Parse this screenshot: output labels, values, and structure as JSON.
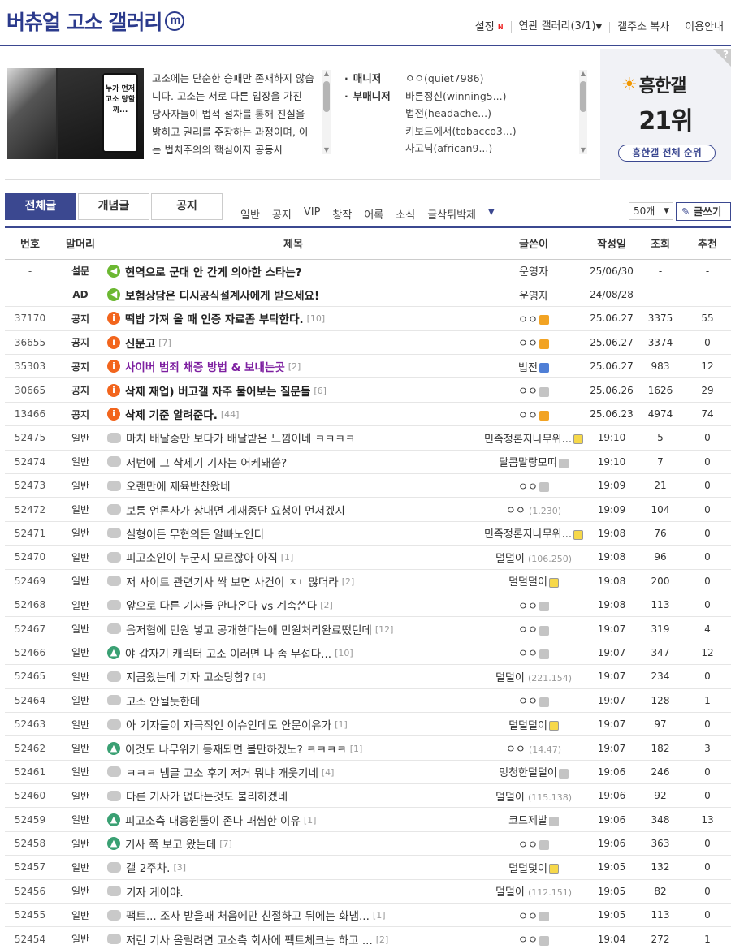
{
  "gallery": {
    "title": "버츄얼 고소 갤러리",
    "mark": "m"
  },
  "top_menu": {
    "settings": "설정",
    "new_mark": "N",
    "related": "연관 갤러리(3/1)",
    "copy_addr": "갤주소 복사",
    "guide": "이용안내"
  },
  "cover": {
    "bubble_text": "누가 먼저 고소 당할까..."
  },
  "description": "고소에는 단순한 승패만 존재하지 않습니다. 고소는 서로 다른 입장을 가진 당사자들이 법적 절차를 통해 진실을 밝히고 권리를 주장하는 과정이며, 이는 법치주의의 핵심이자 공동사",
  "managers": {
    "manager_label": "매니저",
    "manager_name": "ㅇㅇ(quiet7986)",
    "sub_label": "부매니저",
    "sub_names": [
      "바른정신(winning5...)",
      "법전(headache...)",
      "키보드에서(tobacco3...)",
      "사고닉(african9...)"
    ]
  },
  "rank": {
    "title": "흥한갤",
    "value": "21위",
    "button": "흥한갤 전체 순위",
    "help": "?"
  },
  "tabs": [
    "전체글",
    "개념글",
    "공지"
  ],
  "subheads": [
    "일반",
    "공지",
    "VIP",
    "창작",
    "어록",
    "소식",
    "글삭튀박제"
  ],
  "list_controls": {
    "per_page": "50개",
    "write": "글쓰기"
  },
  "columns": [
    "번호",
    "말머리",
    "제목",
    "글쓴이",
    "작성일",
    "조회",
    "추천"
  ],
  "rows": [
    {
      "num": "-",
      "head": "설문",
      "icon": "speaker",
      "title": "현역으로 군대 안 간게 의아한 스타는?",
      "count": "",
      "writer": "운영자",
      "ip": "",
      "badge": "",
      "date": "25/06/30",
      "views": "-",
      "rec": "-",
      "type": "notice"
    },
    {
      "num": "-",
      "head": "AD",
      "icon": "speaker",
      "title": "보험상담은 디시공식설계사에게 받으세요!",
      "count": "",
      "writer": "운영자",
      "ip": "",
      "badge": "",
      "date": "24/08/28",
      "views": "-",
      "rec": "-",
      "type": "notice"
    },
    {
      "num": "37170",
      "head": "공지",
      "icon": "notice-i",
      "title": "떡밥 가져 올 때 인증 자료좀 부탁한다.",
      "count": "[10]",
      "writer": "ㅇㅇ",
      "ip": "",
      "badge": "orange",
      "date": "25.06.27",
      "views": "3375",
      "rec": "55",
      "type": "notice"
    },
    {
      "num": "36655",
      "head": "공지",
      "icon": "notice-i",
      "title": "신문고",
      "count": "[7]",
      "writer": "ㅇㅇ",
      "ip": "",
      "badge": "orange",
      "date": "25.06.27",
      "views": "3374",
      "rec": "0",
      "type": "notice"
    },
    {
      "num": "35303",
      "head": "공지",
      "icon": "notice-i",
      "title": "사이버 범죄 채증 방법 & 보내는곳",
      "count": "[2]",
      "writer": "법전",
      "ip": "",
      "badge": "blue",
      "date": "25.06.27",
      "views": "983",
      "rec": "12",
      "type": "notice purple"
    },
    {
      "num": "30665",
      "head": "공지",
      "icon": "notice-i",
      "title": "삭제 재업) 버고갤 자주 물어보는 질문들",
      "count": "[6]",
      "writer": "ㅇㅇ",
      "ip": "",
      "badge": "gray",
      "date": "25.06.26",
      "views": "1626",
      "rec": "29",
      "type": "notice"
    },
    {
      "num": "13466",
      "head": "공지",
      "icon": "notice-i",
      "title": "삭제 기준 알려준다.",
      "count": "[44]",
      "writer": "ㅇㅇ",
      "ip": "",
      "badge": "orange",
      "date": "25.06.23",
      "views": "4974",
      "rec": "74",
      "type": "notice"
    },
    {
      "num": "52475",
      "head": "일반",
      "icon": "text",
      "title": "마치 배달중만 보다가 배달받은 느낌이네 ㅋㅋㅋㅋ",
      "count": "",
      "writer": "민족정론지나무위...",
      "ip": "",
      "badge": "yellow",
      "date": "19:10",
      "views": "5",
      "rec": "0",
      "type": ""
    },
    {
      "num": "52474",
      "head": "일반",
      "icon": "text",
      "title": "저번에 그 삭제기 기자는 어케돼씀?",
      "count": "",
      "writer": "달콤말랑모띠",
      "ip": "",
      "badge": "gray",
      "date": "19:10",
      "views": "7",
      "rec": "0",
      "type": ""
    },
    {
      "num": "52473",
      "head": "일반",
      "icon": "text",
      "title": "오랜만에 제육반찬왔네",
      "count": "",
      "writer": "ㅇㅇ",
      "ip": "",
      "badge": "gray",
      "date": "19:09",
      "views": "21",
      "rec": "0",
      "type": ""
    },
    {
      "num": "52472",
      "head": "일반",
      "icon": "text",
      "title": "보통 언론사가 상대면 게재중단 요청이 먼저겠지",
      "count": "",
      "writer": "ㅇㅇ",
      "ip": "(1.230)",
      "badge": "",
      "date": "19:09",
      "views": "104",
      "rec": "0",
      "type": ""
    },
    {
      "num": "52471",
      "head": "일반",
      "icon": "text",
      "title": "실형이든 무협의든 알빠노인디",
      "count": "",
      "writer": "민족정론지나무위...",
      "ip": "",
      "badge": "yellow",
      "date": "19:08",
      "views": "76",
      "rec": "0",
      "type": ""
    },
    {
      "num": "52470",
      "head": "일반",
      "icon": "text",
      "title": "피고소인이 누군지 모르잖아 아직",
      "count": "[1]",
      "writer": "덜덜이",
      "ip": "(106.250)",
      "badge": "",
      "date": "19:08",
      "views": "96",
      "rec": "0",
      "type": ""
    },
    {
      "num": "52469",
      "head": "일반",
      "icon": "text",
      "title": "저 사이트 관련기사 싹 보면 사건이 ㅈㄴ많더라",
      "count": "[2]",
      "writer": "덜덜덜이",
      "ip": "",
      "badge": "yellow",
      "date": "19:08",
      "views": "200",
      "rec": "0",
      "type": ""
    },
    {
      "num": "52468",
      "head": "일반",
      "icon": "text",
      "title": "앞으로 다른 기사들 안나온다 vs 계속쓴다",
      "count": "[2]",
      "writer": "ㅇㅇ",
      "ip": "",
      "badge": "gray",
      "date": "19:08",
      "views": "113",
      "rec": "0",
      "type": ""
    },
    {
      "num": "52467",
      "head": "일반",
      "icon": "text",
      "title": "음저협에 민원 넣고 공개한다는애 민원처리완료떴던데",
      "count": "[12]",
      "writer": "ㅇㅇ",
      "ip": "",
      "badge": "gray",
      "date": "19:07",
      "views": "319",
      "rec": "4",
      "type": ""
    },
    {
      "num": "52466",
      "head": "일반",
      "icon": "img",
      "title": "야 갑자기 캐릭터 고소 이러면 나 좀 무섭다...",
      "count": "[10]",
      "writer": "ㅇㅇ",
      "ip": "",
      "badge": "gray",
      "date": "19:07",
      "views": "347",
      "rec": "12",
      "type": ""
    },
    {
      "num": "52465",
      "head": "일반",
      "icon": "text",
      "title": "지금왔는데 기자 고소당함?",
      "count": "[4]",
      "writer": "덜덜이",
      "ip": "(221.154)",
      "badge": "",
      "date": "19:07",
      "views": "234",
      "rec": "0",
      "type": ""
    },
    {
      "num": "52464",
      "head": "일반",
      "icon": "text",
      "title": "고소 안될듯한데",
      "count": "",
      "writer": "ㅇㅇ",
      "ip": "",
      "badge": "gray",
      "date": "19:07",
      "views": "128",
      "rec": "1",
      "type": ""
    },
    {
      "num": "52463",
      "head": "일반",
      "icon": "text",
      "title": "아 기자들이 자극적인 이슈인데도 안문이유가",
      "count": "[1]",
      "writer": "덜덜덜이",
      "ip": "",
      "badge": "yellow",
      "date": "19:07",
      "views": "97",
      "rec": "0",
      "type": ""
    },
    {
      "num": "52462",
      "head": "일반",
      "icon": "img",
      "title": "이것도 나무위키 등재되면 볼만하겠노? ㅋㅋㅋㅋ",
      "count": "[1]",
      "writer": "ㅇㅇ",
      "ip": "(14.47)",
      "badge": "",
      "date": "19:07",
      "views": "182",
      "rec": "3",
      "type": ""
    },
    {
      "num": "52461",
      "head": "일반",
      "icon": "text",
      "title": "ㅋㅋㅋ 넴글 고소 후기 저거 뭐냐 개웃기네",
      "count": "[4]",
      "writer": "멍청한덜덜이",
      "ip": "",
      "badge": "gray",
      "date": "19:06",
      "views": "246",
      "rec": "0",
      "type": ""
    },
    {
      "num": "52460",
      "head": "일반",
      "icon": "text",
      "title": "다른 기사가 없다는것도 불리하겠네",
      "count": "",
      "writer": "덜덜이",
      "ip": "(115.138)",
      "badge": "",
      "date": "19:06",
      "views": "92",
      "rec": "0",
      "type": ""
    },
    {
      "num": "52459",
      "head": "일반",
      "icon": "img",
      "title": "피고소측 대응원툴이 존나 괘씸한 이유",
      "count": "[1]",
      "writer": "코드제발",
      "ip": "",
      "badge": "gray",
      "date": "19:06",
      "views": "348",
      "rec": "13",
      "type": ""
    },
    {
      "num": "52458",
      "head": "일반",
      "icon": "img",
      "title": "기사 쭉 보고 왔는데",
      "count": "[7]",
      "writer": "ㅇㅇ",
      "ip": "",
      "badge": "gray",
      "date": "19:06",
      "views": "363",
      "rec": "0",
      "type": ""
    },
    {
      "num": "52457",
      "head": "일반",
      "icon": "text",
      "title": "갤 2주차.",
      "count": "[3]",
      "writer": "덜덜덫이",
      "ip": "",
      "badge": "yellow",
      "date": "19:05",
      "views": "132",
      "rec": "0",
      "type": ""
    },
    {
      "num": "52456",
      "head": "일반",
      "icon": "text",
      "title": "기자 게이야.",
      "count": "",
      "writer": "덜덜이",
      "ip": "(112.151)",
      "badge": "",
      "date": "19:05",
      "views": "82",
      "rec": "0",
      "type": ""
    },
    {
      "num": "52455",
      "head": "일반",
      "icon": "text",
      "title": "팩트... 조사 받을때 처음에만 친절하고 뒤에는 화냄...",
      "count": "[1]",
      "writer": "ㅇㅇ",
      "ip": "",
      "badge": "gray",
      "date": "19:05",
      "views": "113",
      "rec": "0",
      "type": ""
    },
    {
      "num": "52454",
      "head": "일반",
      "icon": "text",
      "title": "저런 기사 올릴려면 고소측 회사에 팩트체크는 하고 ...",
      "count": "[2]",
      "writer": "ㅇㅇ",
      "ip": "",
      "badge": "gray",
      "date": "19:04",
      "views": "272",
      "rec": "1",
      "type": ""
    }
  ],
  "colors": {
    "brand": "#3b4890",
    "notice_icon": "#f2651d",
    "speaker_icon": "#6cb832",
    "purple_title": "#7d1fa0"
  }
}
